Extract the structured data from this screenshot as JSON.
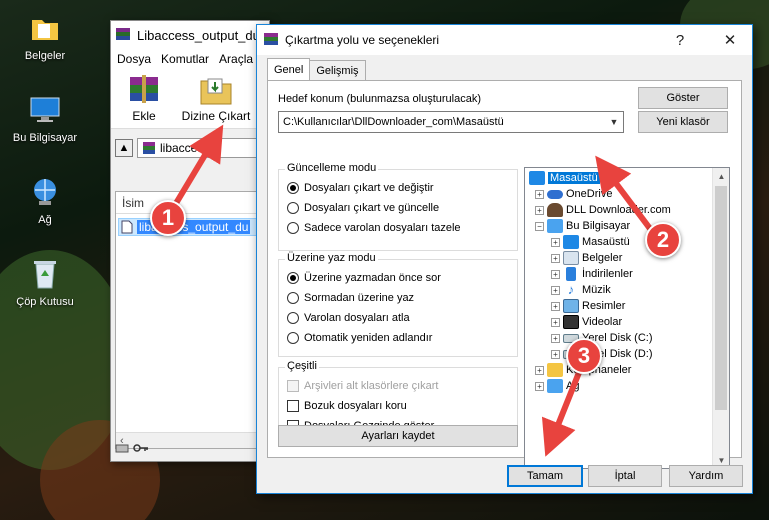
{
  "desktop": {
    "icons": [
      {
        "label": "Belgeler",
        "icon": "folder-documents-icon"
      },
      {
        "label": "Bu Bilgisayar",
        "icon": "computer-icon"
      },
      {
        "label": "Ağ",
        "icon": "network-icon"
      },
      {
        "label": "Çöp Kutusu",
        "icon": "recycle-bin-icon"
      }
    ]
  },
  "winrar": {
    "title": "Libaccess_output_du",
    "menu": [
      "Dosya",
      "Komutlar",
      "Araçla"
    ],
    "toolbar": {
      "add_label": "Ekle",
      "extract_label": "Dizine Çıkart"
    },
    "address": "libaccess_",
    "column_name": "İsim",
    "file": "libaccess_output_du"
  },
  "dialog": {
    "title": "Çıkartma yolu ve seçenekleri",
    "tabs": [
      "Genel",
      "Gelişmiş"
    ],
    "dest_label": "Hedef konum (bulunmazsa oluşturulacak)",
    "dest_value": "C:\\Kullanıcılar\\DllDownloader_com\\Masaüstü",
    "show_button": "Göster",
    "new_folder_button": "Yeni klasör",
    "update_mode": {
      "title": "Güncelleme modu",
      "options": [
        "Dosyaları çıkart ve değiştir",
        "Dosyaları çıkart ve güncelle",
        "Sadece varolan dosyaları tazele"
      ],
      "selected": 0
    },
    "overwrite_mode": {
      "title": "Üzerine yaz modu",
      "options": [
        "Üzerine yazmadan önce sor",
        "Sormadan üzerine yaz",
        "Varolan dosyaları atla",
        "Otomatik yeniden adlandır"
      ],
      "selected": 0
    },
    "misc": {
      "title": "Çeşitli",
      "options": [
        "Arşivleri alt klasörlere çıkart",
        "Bozuk dosyaları koru",
        "Dosyaları Gezginde göster"
      ]
    },
    "save_settings_button": "Ayarları kaydet",
    "tree": {
      "items": [
        {
          "label": "Masaüstü",
          "level": 0,
          "selected": true
        },
        {
          "label": "OneDrive",
          "level": 1
        },
        {
          "label": "DLL Downloader.com",
          "level": 1
        },
        {
          "label": "Bu Bilgisayar",
          "level": 1
        },
        {
          "label": "Masaüstü",
          "level": 2
        },
        {
          "label": "Belgeler",
          "level": 2
        },
        {
          "label": "İndirilenler",
          "level": 2
        },
        {
          "label": "Müzik",
          "level": 2
        },
        {
          "label": "Resimler",
          "level": 2
        },
        {
          "label": "Videolar",
          "level": 2
        },
        {
          "label": "Yerel Disk (C:)",
          "level": 2
        },
        {
          "label": "Yerel Disk (D:)",
          "level": 2
        },
        {
          "label": "Kütüphaneler",
          "level": 1
        },
        {
          "label": "Ağ",
          "level": 1
        }
      ]
    },
    "ok_button": "Tamam",
    "cancel_button": "İptal",
    "help_button": "Yardım"
  },
  "annotations": {
    "badge1": "1",
    "badge2": "2",
    "badge3": "3"
  },
  "colors": {
    "accent": "#0078d7",
    "badge": "#e8433e"
  }
}
